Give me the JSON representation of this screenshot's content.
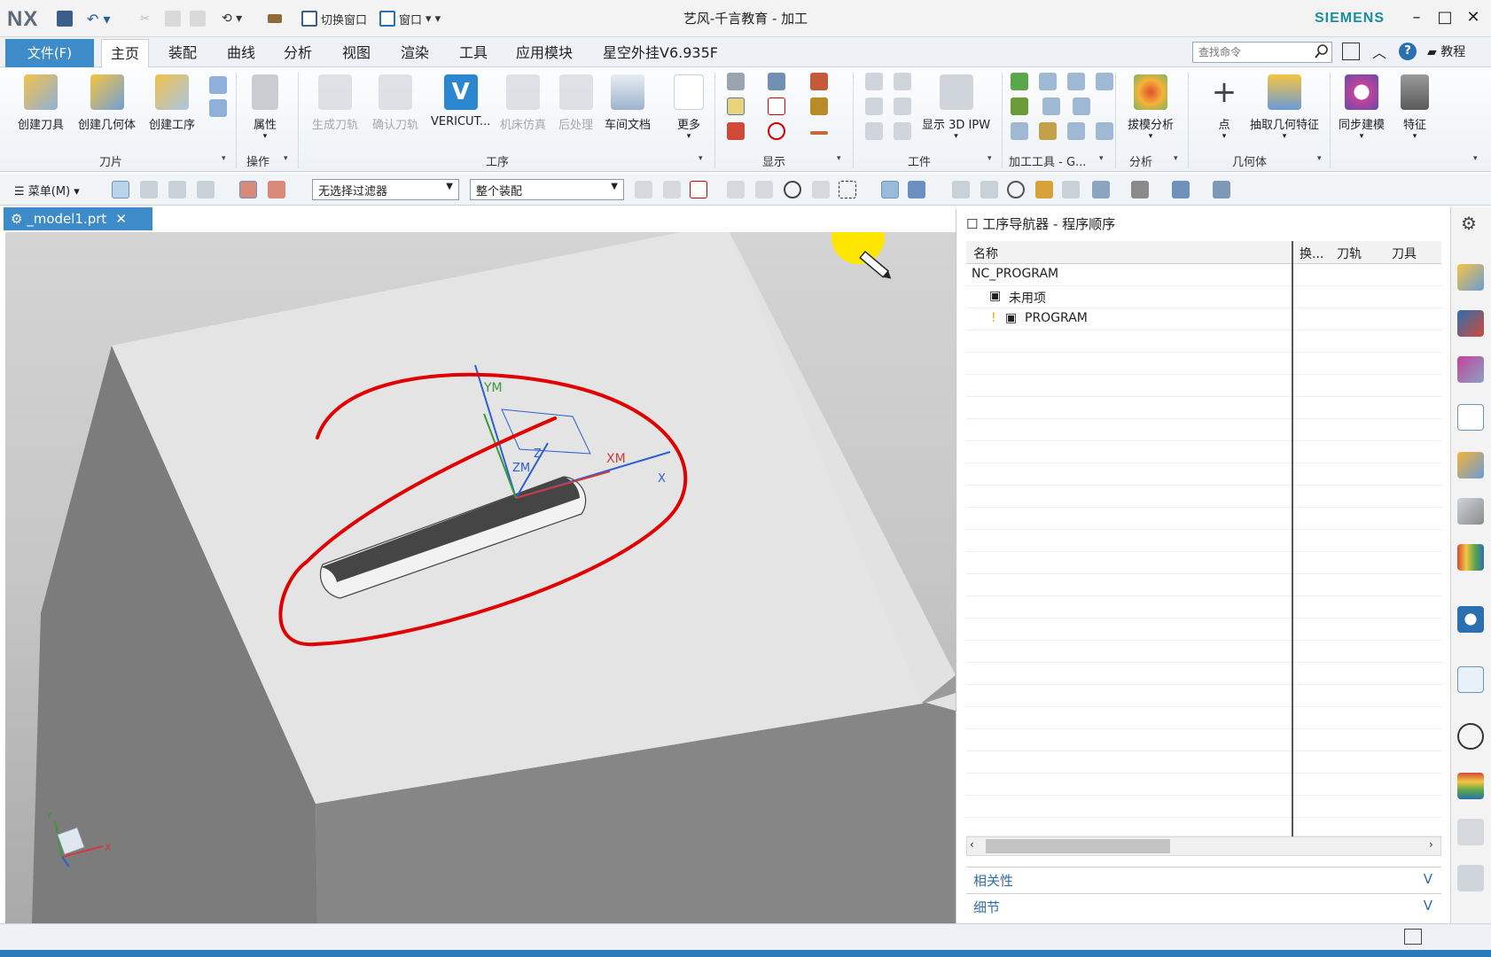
{
  "app": {
    "logo": "NX",
    "window_title": "艺风-千言教育 - 加工",
    "brand": "SIEMENS",
    "switch_window": "切换窗口",
    "window_menu": "窗口",
    "tutorial": "教程"
  },
  "tabs": [
    "文件(F)",
    "主页",
    "装配",
    "曲线",
    "分析",
    "视图",
    "渲染",
    "工具",
    "应用模块",
    "星空外挂V6.935F"
  ],
  "search": {
    "placeholder": "查找命令"
  },
  "ribbon": {
    "tool": {
      "create_tool": "创建刀具",
      "create_geometry": "创建几何体",
      "create_operation": "创建工序",
      "group": "刀片"
    },
    "ops": {
      "properties": "属性",
      "group": "操作"
    },
    "process": {
      "generate_path": "生成刀轨",
      "verify_path": "确认刀轨",
      "vericut": "VERICUT...",
      "machine_sim": "机床仿真",
      "postprocess": "后处理",
      "shop_doc": "车间文档",
      "more": "更多",
      "group": "工序"
    },
    "display": {
      "group": "显示"
    },
    "workpiece": {
      "show_ipw": "显示 3D IPW",
      "group": "工件"
    },
    "mfg_tools": {
      "group": "加工工具 - G..."
    },
    "analysis": {
      "draft": "拔模分析",
      "group": "分析"
    },
    "geometry": {
      "point": "点",
      "extract": "抽取几何特征",
      "group": "几何体"
    },
    "sync": {
      "label": "同步建模"
    },
    "feature": {
      "label": "特征"
    }
  },
  "toolbar2": {
    "menu": "菜单(M)",
    "filter": "无选择过滤器",
    "scope": "整个装配"
  },
  "graphics_tab": {
    "label": "_model1.prt"
  },
  "navigator": {
    "title": "工序导航器 - 程序顺序",
    "columns": [
      "名称",
      "换...",
      "刀轨",
      "刀具"
    ],
    "rows": [
      "NC_PROGRAM",
      "未用项",
      "PROGRAM"
    ],
    "panels": [
      "相关性",
      "细节"
    ]
  },
  "viewport": {
    "axis_labels": {
      "ym": "YM",
      "xm": "XM",
      "zm": "ZM",
      "x": "X",
      "z": "Z",
      "triad_x": "X",
      "triad_y": "Y"
    }
  },
  "colors": {
    "accent": "#3d8bc8",
    "annotation": "#e00000",
    "brand": "#1a8fa0"
  }
}
